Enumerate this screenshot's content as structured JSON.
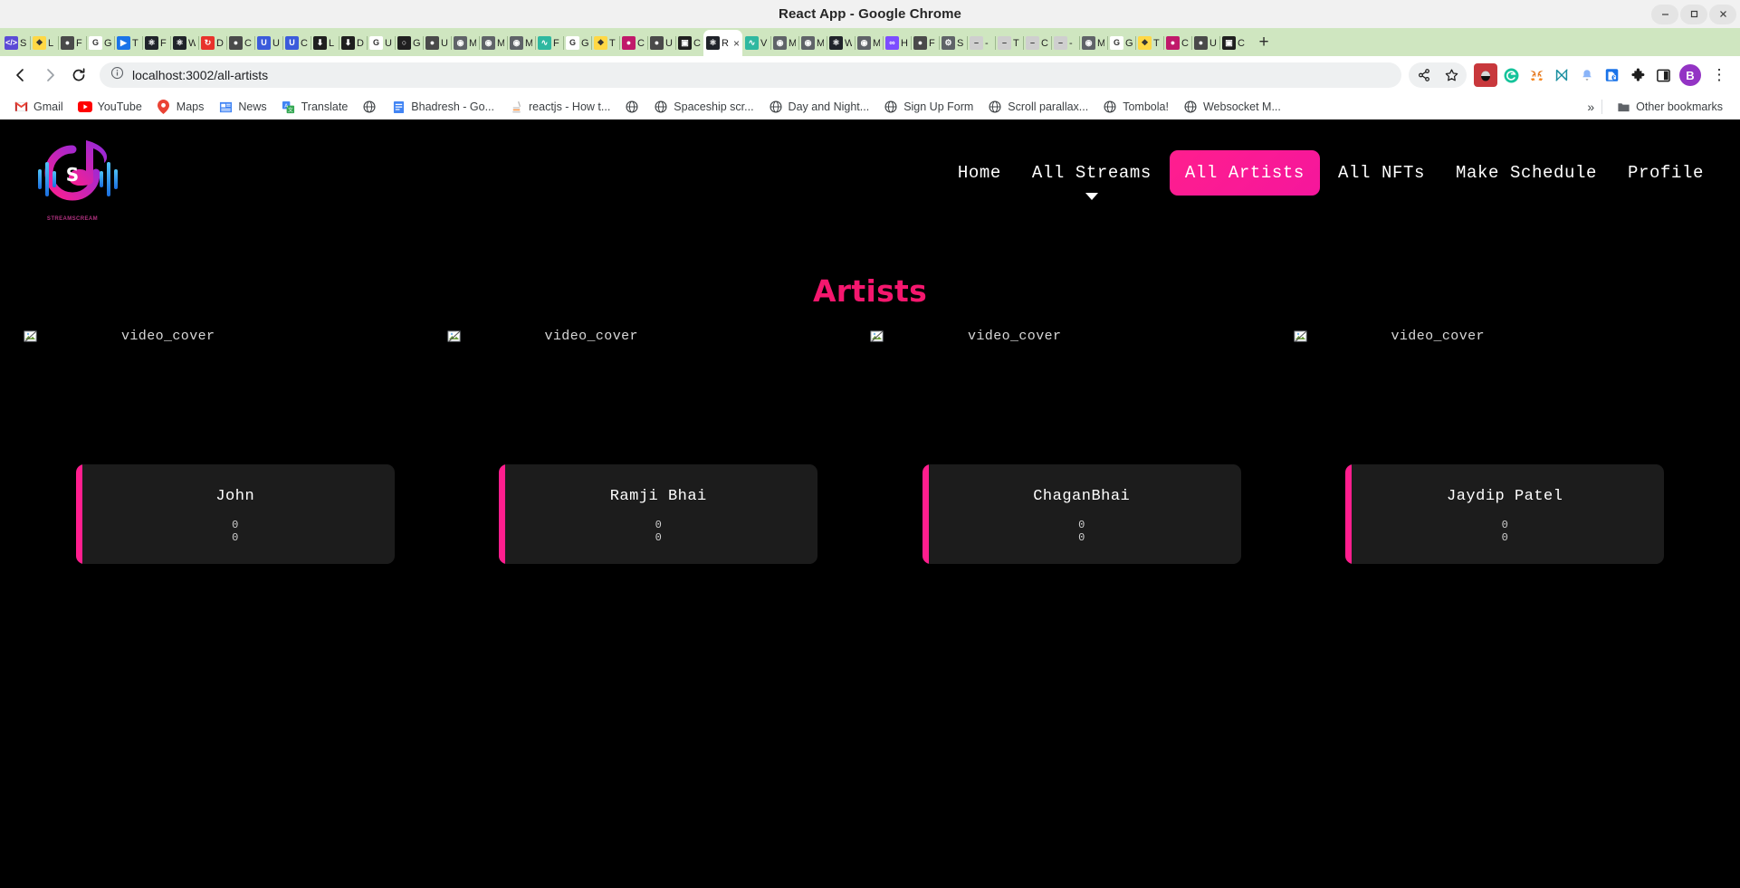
{
  "window": {
    "title": "React App - Google Chrome",
    "controls": [
      {
        "name": "minimize",
        "glyph": "minimize-icon"
      },
      {
        "name": "maximize",
        "glyph": "maximize-icon"
      },
      {
        "name": "close",
        "glyph": "close-icon"
      }
    ]
  },
  "tabstrip": {
    "new_tab_label": "+",
    "active_tab": {
      "title": "R",
      "close_label": "×",
      "favicon": "react-icon"
    },
    "tabs": [
      {
        "title": "S",
        "favicon_color": "#5b4bd6",
        "favicon_text": "</>"
      },
      {
        "title": "L",
        "favicon_color": "#ffd845",
        "favicon_text": "❖"
      },
      {
        "title": "F",
        "favicon_color": "#4a4a4a",
        "favicon_text": "●"
      },
      {
        "title": "G",
        "favicon_color": "#ffffff",
        "favicon_text": "G"
      },
      {
        "title": "T",
        "favicon_color": "#1a73e8",
        "favicon_text": "▶"
      },
      {
        "title": "F",
        "favicon_color": "#20232a",
        "favicon_text": "⚛"
      },
      {
        "title": "W",
        "favicon_color": "#20232a",
        "favicon_text": "⚛"
      },
      {
        "title": "D",
        "favicon_color": "#e8322b",
        "favicon_text": "↻"
      },
      {
        "title": "C",
        "favicon_color": "#4a4a4a",
        "favicon_text": "●"
      },
      {
        "title": "U",
        "favicon_color": "#3b5bdb",
        "favicon_text": "U"
      },
      {
        "title": "C",
        "favicon_color": "#3b5bdb",
        "favicon_text": "U"
      },
      {
        "title": "L",
        "favicon_color": "#1f1f1f",
        "favicon_text": "⬇"
      },
      {
        "title": "D",
        "favicon_color": "#1f1f1f",
        "favicon_text": "⬇"
      },
      {
        "title": "U",
        "favicon_color": "#ffffff",
        "favicon_text": "G"
      },
      {
        "title": "G",
        "favicon_color": "#1f1f1f",
        "favicon_text": "○"
      },
      {
        "title": "U",
        "favicon_color": "#4a4a4a",
        "favicon_text": "●"
      },
      {
        "title": "M",
        "favicon_color": "#5f6368",
        "favicon_text": "◉"
      },
      {
        "title": "M",
        "favicon_color": "#5f6368",
        "favicon_text": "◉"
      },
      {
        "title": "M",
        "favicon_color": "#5f6368",
        "favicon_text": "◉"
      },
      {
        "title": "F",
        "favicon_color": "#2fb8a0",
        "favicon_text": "∿"
      },
      {
        "title": "G",
        "favicon_color": "#ffffff",
        "favicon_text": "G"
      },
      {
        "title": "T",
        "favicon_color": "#ffd845",
        "favicon_text": "❖"
      },
      {
        "title": "C",
        "favicon_color": "#c0196a",
        "favicon_text": "●"
      },
      {
        "title": "U",
        "favicon_color": "#4a4a4a",
        "favicon_text": "●"
      },
      {
        "title": "C",
        "favicon_color": "#1f1f1f",
        "favicon_text": "▣"
      },
      {
        "title": "R",
        "favicon_color": "#20232a",
        "favicon_text": "⚛"
      },
      {
        "title": "V",
        "favicon_color": "#2fb8a0",
        "favicon_text": "∿"
      },
      {
        "title": "M",
        "favicon_color": "#5f6368",
        "favicon_text": "◉"
      },
      {
        "title": "M",
        "favicon_color": "#5f6368",
        "favicon_text": "◉"
      },
      {
        "title": "W",
        "favicon_color": "#20232a",
        "favicon_text": "⚛"
      },
      {
        "title": "M",
        "favicon_color": "#5f6368",
        "favicon_text": "◉"
      },
      {
        "title": "H",
        "favicon_color": "#7c4dff",
        "favicon_text": "∞"
      },
      {
        "title": "F",
        "favicon_color": "#4a4a4a",
        "favicon_text": "●"
      },
      {
        "title": "S",
        "favicon_color": "#5f6368",
        "favicon_text": "⚙"
      },
      {
        "title": "-",
        "favicon_color": "#cfcfcf",
        "favicon_text": "–"
      },
      {
        "title": "T",
        "favicon_color": "#cfcfcf",
        "favicon_text": "–"
      },
      {
        "title": "C",
        "favicon_color": "#cfcfcf",
        "favicon_text": "–"
      },
      {
        "title": "-",
        "favicon_color": "#cfcfcf",
        "favicon_text": "–"
      },
      {
        "title": "M",
        "favicon_color": "#5f6368",
        "favicon_text": "◉"
      },
      {
        "title": "G",
        "favicon_color": "#ffffff",
        "favicon_text": "G"
      },
      {
        "title": "T",
        "favicon_color": "#ffd845",
        "favicon_text": "❖"
      },
      {
        "title": "C",
        "favicon_color": "#c0196a",
        "favicon_text": "●"
      },
      {
        "title": "U",
        "favicon_color": "#4a4a4a",
        "favicon_text": "●"
      },
      {
        "title": "C",
        "favicon_color": "#1f1f1f",
        "favicon_text": "▣"
      }
    ]
  },
  "toolbar": {
    "back_label": "back-arrow",
    "forward_label": "forward-arrow",
    "reload_label": "reload",
    "url": "localhost:3002/all-artists",
    "site_info_label": "info-icon",
    "share_label": "share-icon",
    "bookmark_label": "star-icon",
    "extensions": [
      {
        "name": "ladybug-extension",
        "glyph": "🐞",
        "color": "#c8383c"
      },
      {
        "name": "grammarly-extension",
        "glyph": "G",
        "color": "#15c39a"
      },
      {
        "name": "metamask-extension",
        "glyph": "🦊",
        "color": "#f6851b"
      },
      {
        "name": "nifty-extension",
        "glyph": "N",
        "color": "#1a8fa0"
      },
      {
        "name": "bell-extension",
        "glyph": "🔔",
        "color": "#8ab4f8"
      },
      {
        "name": "lock-extension",
        "glyph": "🔒",
        "color": "#1a73e8"
      },
      {
        "name": "puzzle-extensions",
        "glyph": "🧩",
        "color": "#1f1f1f"
      },
      {
        "name": "split-screen",
        "glyph": "▣",
        "color": "#1f1f1f"
      }
    ],
    "profile_initial": "B",
    "menu_label": "⋮"
  },
  "bookmarks": {
    "items": [
      {
        "label": "Gmail",
        "icon": "gmail-icon"
      },
      {
        "label": "YouTube",
        "icon": "youtube-icon"
      },
      {
        "label": "Maps",
        "icon": "maps-icon"
      },
      {
        "label": "News",
        "icon": "news-icon"
      },
      {
        "label": "Translate",
        "icon": "translate-icon"
      },
      {
        "label": "",
        "icon": "globe-icon"
      },
      {
        "label": "Bhadresh - Go...",
        "icon": "doc-icon"
      },
      {
        "label": "reactjs - How t...",
        "icon": "stack-icon"
      },
      {
        "label": "",
        "icon": "globe-icon"
      },
      {
        "label": "Spaceship scr...",
        "icon": "globe-icon"
      },
      {
        "label": "Day and Night...",
        "icon": "globe-icon"
      },
      {
        "label": "Sign Up Form",
        "icon": "globe-icon"
      },
      {
        "label": "Scroll parallax...",
        "icon": "globe-icon"
      },
      {
        "label": "Tombola!",
        "icon": "globe-icon"
      },
      {
        "label": "Websocket M...",
        "icon": "globe-icon"
      }
    ],
    "overflow_label": "»",
    "other_bookmarks_label": "Other bookmarks",
    "other_bookmarks_icon": "folder-icon"
  },
  "site": {
    "logo_name": "STREAMSCREAM",
    "nav": [
      {
        "label": "Home",
        "active": false,
        "caret": false
      },
      {
        "label": "All Streams",
        "active": false,
        "caret": true
      },
      {
        "label": "All Artists",
        "active": true,
        "caret": false
      },
      {
        "label": "All NFTs",
        "active": false,
        "caret": false
      },
      {
        "label": "Make Schedule",
        "active": false,
        "caret": false
      },
      {
        "label": "Profile",
        "active": false,
        "caret": false
      }
    ],
    "page_title": "Artists",
    "cover_alt": "video_cover",
    "accent_color": "#ff1e8e",
    "title_color": "#f5176e",
    "artists": [
      {
        "name": "John",
        "stat1": "0",
        "stat2": "0"
      },
      {
        "name": "Ramji Bhai",
        "stat1": "0",
        "stat2": "0"
      },
      {
        "name": "ChaganBhai",
        "stat1": "0",
        "stat2": "0"
      },
      {
        "name": "Jaydip Patel",
        "stat1": "0",
        "stat2": "0"
      }
    ]
  }
}
